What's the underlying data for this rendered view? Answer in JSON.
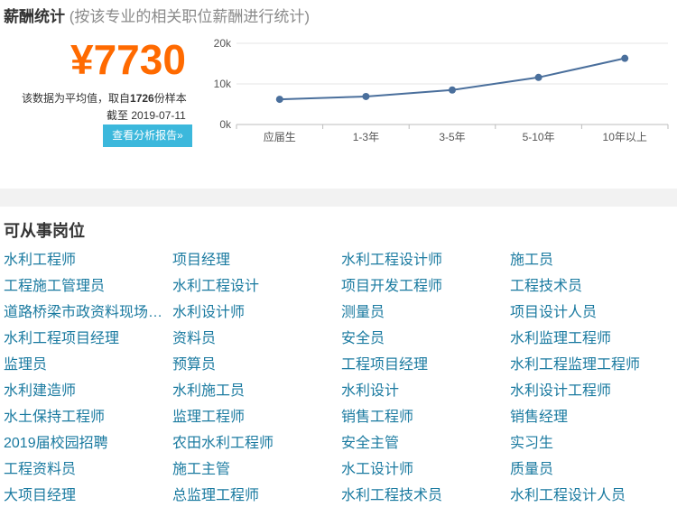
{
  "salary": {
    "title": "薪酬统计",
    "subtitle": "(按该专业的相关职位薪酬进行统计)",
    "value": "¥7730",
    "note_prefix": "该数据为平均值，取自",
    "sample_count": "1726",
    "note_suffix": "份样本",
    "date_line": "截至 2019-07-11",
    "button_label": "查看分析报告»"
  },
  "chart_data": {
    "type": "line",
    "categories": [
      "应届生",
      "1-3年",
      "3-5年",
      "5-10年",
      "10年以上"
    ],
    "series": [
      {
        "values": [
          6200,
          6900,
          8500,
          11600,
          16300
        ]
      }
    ],
    "y_ticks": [
      "0k",
      "10k",
      "20k"
    ],
    "ylim": [
      0,
      20000
    ],
    "grid": true,
    "colors": {
      "line": "#4a6f9c",
      "point": "#4a6f9c",
      "grid": "#e6e6e6",
      "axis": "#bdbdbd"
    }
  },
  "jobs": {
    "title": "可从事岗位",
    "items": [
      "水利工程师",
      "项目经理",
      "水利工程设计师",
      "施工员",
      "工程施工管理员",
      "水利工程设计",
      "项目开发工程师",
      "工程技术员",
      "道路桥梁市政资料现场技术员",
      "水利设计师",
      "测量员",
      "项目设计人员",
      "水利工程项目经理",
      "资料员",
      "安全员",
      "水利监理工程师",
      "监理员",
      "预算员",
      "工程项目经理",
      "水利工程监理工程师",
      "水利建造师",
      "水利施工员",
      "水利设计",
      "水利设计工程师",
      "水土保持工程师",
      "监理工程师",
      "销售工程师",
      "销售经理",
      "2019届校园招聘",
      "农田水利工程师",
      "安全主管",
      "实习生",
      "工程资料员",
      "施工主管",
      "水工设计师",
      "质量员",
      "大项目经理",
      "总监理工程师",
      "水利工程技术员",
      "水利工程设计人员"
    ]
  }
}
